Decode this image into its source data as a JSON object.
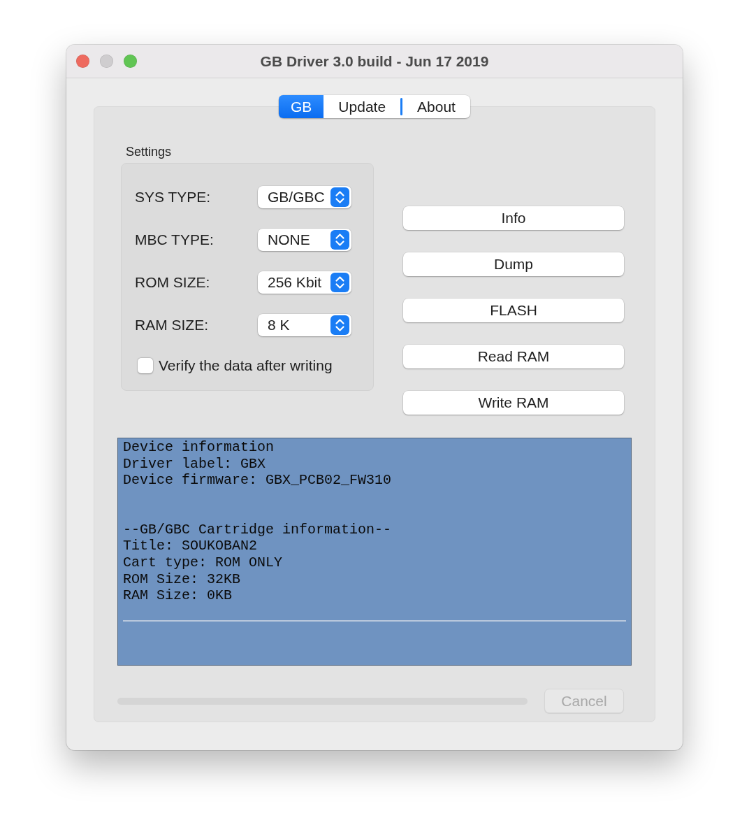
{
  "window": {
    "title": "GB Driver 3.0 build - Jun 17 2019",
    "controls": [
      {
        "kind": "close",
        "disabled": false
      },
      {
        "kind": "minimize",
        "disabled": true
      },
      {
        "kind": "zoom",
        "disabled": false
      }
    ]
  },
  "tabs": [
    {
      "label": "GB",
      "selected": true
    },
    {
      "label": "Update",
      "selected": false
    },
    {
      "label": "About",
      "selected": false
    }
  ],
  "settings": {
    "title": "Settings",
    "fields": [
      {
        "label": "SYS TYPE:",
        "value": "GB/GBC"
      },
      {
        "label": "MBC TYPE:",
        "value": "NONE"
      },
      {
        "label": "ROM SIZE:",
        "value": "256 Kbit"
      },
      {
        "label": "RAM SIZE:",
        "value": "8 K"
      }
    ],
    "verify": {
      "label": "Verify the data after writing",
      "checked": false
    }
  },
  "buttons": [
    "Info",
    "Dump",
    "FLASH",
    "Read RAM",
    "Write RAM"
  ],
  "log": {
    "sections": [
      {
        "lines": [
          "Device information",
          "Driver label: GBX",
          "Device firmware: GBX_PCB02_FW310"
        ]
      },
      {
        "lines": [
          "--GB/GBC Cartridge information--",
          "Title: SOUKOBAN2",
          "Cart type: ROM ONLY",
          "ROM Size: 32KB",
          "RAM Size: 0KB"
        ]
      }
    ]
  },
  "progress": {
    "level": 0
  },
  "cancel": {
    "label": "Cancel",
    "disabled": true
  }
}
